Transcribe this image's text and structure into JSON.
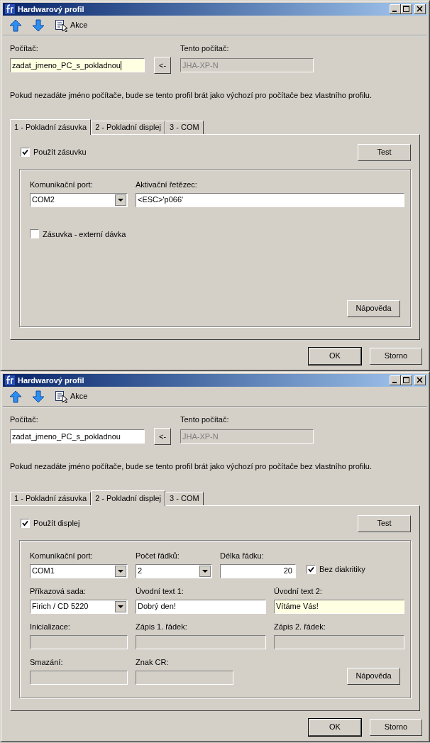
{
  "windows": [
    {
      "title": "Hardwarový profil",
      "toolbar": [
        {
          "kind": "up"
        },
        {
          "kind": "down"
        },
        {
          "kind": "action",
          "label": "Akce"
        }
      ],
      "computer": {
        "label": "Počítač:",
        "value": "zadat_jmeno_PC_s_pokladnou",
        "focused": true
      },
      "copy_button": "<-",
      "this_computer": {
        "label": "Tento počítač:",
        "value": "JHA-XP-N",
        "disabled": true
      },
      "note": "Pokud nezadáte jméno počítače, bude se tento profil brát jako výchozí pro počítače bez vlastního profilu.",
      "tabs": [
        {
          "label": "1 - Pokladní zásuvka",
          "selected": true
        },
        {
          "label": "2 - Pokladní displej",
          "selected": false
        },
        {
          "label": "3 - COM",
          "selected": false
        }
      ],
      "panel": {
        "kind": "drawer",
        "enable": {
          "label": "Použít zásuvku",
          "checked": true
        },
        "test_button": "Test",
        "rows": [
          [
            {
              "kind": "combo",
              "label": "Komunikační port:",
              "value": "COM2",
              "disabled": false,
              "focused": false
            },
            {
              "kind": "text",
              "label": "Aktivační řetězec:",
              "value": "<ESC>'p066'",
              "disabled": false,
              "focused": false
            }
          ],
          [
            {
              "kind": "checkbox",
              "label": "Zásuvka - externí dávka",
              "checked": false
            }
          ]
        ],
        "help_button": "Nápověda"
      },
      "buttons": [
        {
          "label": "OK",
          "default": true
        },
        {
          "label": "Storno",
          "default": false
        }
      ]
    },
    {
      "title": "Hardwarový profil",
      "toolbar": [
        {
          "kind": "up"
        },
        {
          "kind": "down"
        },
        {
          "kind": "action",
          "label": "Akce"
        }
      ],
      "computer": {
        "label": "Počítač:",
        "value": "zadat_jmeno_PC_s_pokladnou",
        "focused": false
      },
      "copy_button": "<-",
      "this_computer": {
        "label": "Tento počítač:",
        "value": "JHA-XP-N",
        "disabled": true
      },
      "note": "Pokud nezadáte jméno počítače, bude se tento profil brát jako výchozí pro počítače bez vlastního profilu.",
      "tabs": [
        {
          "label": "1 - Pokladní zásuvka",
          "selected": false
        },
        {
          "label": "2 - Pokladní displej",
          "selected": true
        },
        {
          "label": "3 - COM",
          "selected": false
        }
      ],
      "panel": {
        "kind": "display",
        "enable": {
          "label": "Použít displej",
          "checked": true
        },
        "test_button": "Test",
        "rows": [
          [
            {
              "kind": "combo",
              "label": "Komunikační port:",
              "value": "COM1",
              "disabled": false,
              "focused": false
            },
            {
              "kind": "combo",
              "label": "Počet řádků:",
              "value": "2",
              "disabled": false,
              "focused": false
            },
            {
              "kind": "number",
              "label": "Délka řádku:",
              "value": "20",
              "disabled": false,
              "focused": false
            },
            {
              "kind": "checkbox",
              "label": "Bez diakritiky",
              "checked": true
            }
          ],
          [
            {
              "kind": "combo",
              "label": "Příkazová sada:",
              "value": "Firich / CD 5220",
              "disabled": false,
              "focused": false
            },
            {
              "kind": "text",
              "label": "Úvodní text 1:",
              "value": "Dobrý den!",
              "disabled": false,
              "focused": false
            },
            {
              "kind": "text",
              "label": "Úvodní text 2:",
              "value": "Vítáme Vás!",
              "disabled": false,
              "focused": true
            }
          ],
          [
            {
              "kind": "text",
              "label": "Inicializace:",
              "disabled": true,
              "focused": false
            },
            {
              "kind": "text",
              "label": "Zápis 1. řádek:",
              "disabled": true,
              "focused": false
            },
            {
              "kind": "text",
              "label": "Zápis 2. řádek:",
              "disabled": true,
              "focused": false
            }
          ],
          [
            {
              "kind": "text",
              "label": "Smazání:",
              "disabled": true,
              "focused": false
            },
            {
              "kind": "text",
              "label": "Znak CR:",
              "disabled": true,
              "focused": false
            }
          ]
        ],
        "help_button": "Nápověda"
      },
      "buttons": [
        {
          "label": "OK",
          "default": true
        },
        {
          "label": "Storno",
          "default": false
        }
      ]
    }
  ]
}
